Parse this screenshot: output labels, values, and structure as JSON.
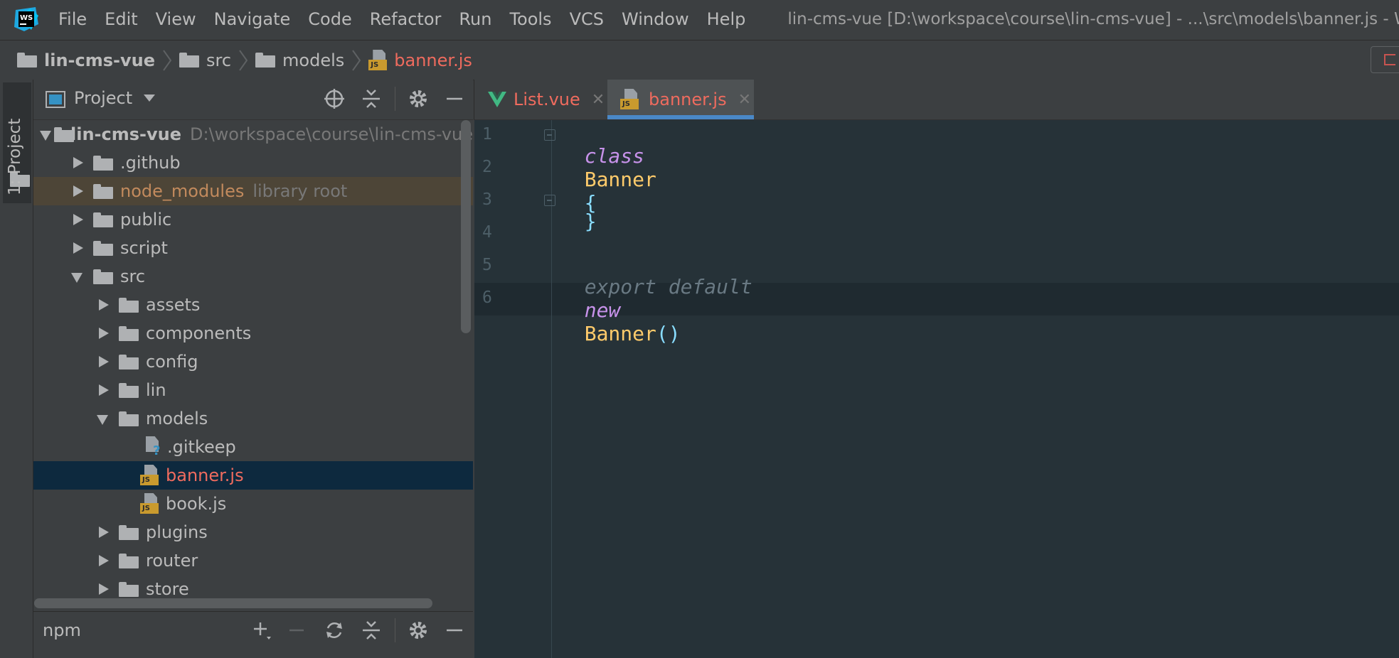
{
  "menubar": {
    "items": [
      {
        "label": "File"
      },
      {
        "label": "Edit"
      },
      {
        "label": "View"
      },
      {
        "label": "Navigate"
      },
      {
        "label": "Code"
      },
      {
        "label": "Refactor"
      },
      {
        "label": "Run"
      },
      {
        "label": "Tools"
      },
      {
        "label": "VCS"
      },
      {
        "label": "Window"
      },
      {
        "label": "Help"
      }
    ],
    "window_title": "lin-cms-vue [D:\\workspace\\course\\lin-cms-vue] - ...\\src\\models\\banner.js - W"
  },
  "breadcrumb": {
    "items": [
      "lin-cms-vue",
      "src",
      "models",
      "banner.js"
    ]
  },
  "stripe": {
    "label": "1: Project"
  },
  "project_panel": {
    "title": "Project",
    "tree": [
      {
        "label": "lin-cms-vue",
        "hint": "D:\\workspace\\course\\lin-cms-vue"
      },
      {
        "label": ".github"
      },
      {
        "label": "node_modules",
        "hint": "library root"
      },
      {
        "label": "public"
      },
      {
        "label": "script"
      },
      {
        "label": "src"
      },
      {
        "label": "assets"
      },
      {
        "label": "components"
      },
      {
        "label": "config"
      },
      {
        "label": "lin"
      },
      {
        "label": "models"
      },
      {
        "label": ".gitkeep"
      },
      {
        "label": "banner.js"
      },
      {
        "label": "book.js"
      },
      {
        "label": "plugins"
      },
      {
        "label": "router"
      },
      {
        "label": "store"
      }
    ]
  },
  "npm_panel": {
    "title": "npm"
  },
  "editor": {
    "tabs": [
      {
        "label": "List.vue"
      },
      {
        "label": "banner.js"
      }
    ],
    "line_numbers": [
      "1",
      "2",
      "3",
      "4",
      "5",
      "6"
    ],
    "code": {
      "l1_kw": "class",
      "l1_name": "Banner",
      "l1_brace": "{",
      "l3_brace": "}",
      "l5_export": "export default",
      "l5_new": "new",
      "l5_name": "Banner",
      "l5_parens": "()"
    }
  },
  "colors": {
    "modified_file": "#ef6b5e",
    "selection": "#0d293e",
    "editor_bg": "#263238",
    "keyword": "#c792ea",
    "class_name": "#ffcb6b",
    "punct": "#89ddff"
  }
}
